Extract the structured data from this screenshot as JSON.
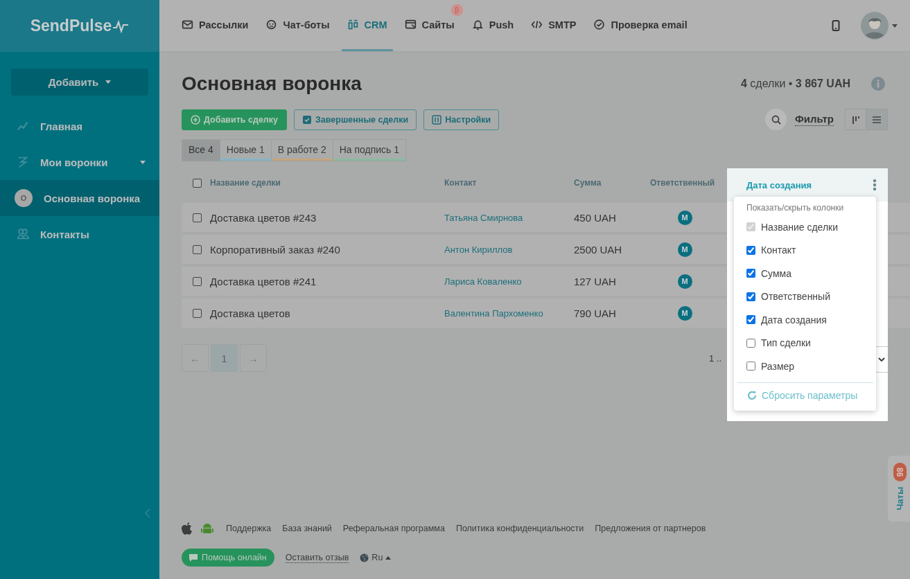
{
  "logo": {
    "text": "SendPulse"
  },
  "nav": [
    {
      "label": "Рассылки",
      "selected": false
    },
    {
      "label": "Чат-боты",
      "selected": false
    },
    {
      "label": "CRM",
      "selected": true
    },
    {
      "label": "Сайты",
      "selected": false,
      "badge": "β"
    },
    {
      "label": "Push",
      "selected": false
    },
    {
      "label": "SMTP",
      "selected": false
    },
    {
      "label": "Проверка email",
      "selected": false
    }
  ],
  "sidebar": {
    "add_button": "Добавить",
    "items": [
      {
        "label": "Главная",
        "selected": false
      },
      {
        "label": "Мои воронки",
        "selected": false,
        "expanded": true,
        "children": [
          {
            "label": "Основная воронка",
            "avatar": "О",
            "selected": true
          }
        ]
      },
      {
        "label": "Контакты",
        "selected": false
      }
    ]
  },
  "page": {
    "title": "Основная воронка",
    "summary": "**4** сделки • **3 867 UAH**"
  },
  "actions": [
    {
      "label": "Добавить сделку",
      "kind": "primary"
    },
    {
      "label": "Завершенные сделки",
      "kind": "outline"
    },
    {
      "label": "Настройки",
      "kind": "outline"
    }
  ],
  "filter": {
    "label": "Фильтр"
  },
  "views": [
    {
      "kind": "kanban",
      "selected": false
    },
    {
      "kind": "list",
      "selected": true
    }
  ],
  "stages": [
    {
      "label": "Все 4",
      "selected": true
    },
    {
      "label": "Новые 1",
      "selected": false,
      "color": "#86b3c4"
    },
    {
      "label": "В работе 2",
      "selected": false,
      "color": "#c7a37c"
    },
    {
      "label": "На подпись 1",
      "selected": false,
      "color": "#88bb9f"
    }
  ],
  "table": {
    "select_all": {
      "checked": false
    },
    "columns": [
      "Название сделки",
      "Контакт",
      "Сумма",
      "Ответственный",
      "Дата создания"
    ],
    "rows": [
      {
        "checked": false,
        "name": "Доставка цветов #243",
        "contact": "Татьяна Смирнова",
        "amount": "450 UAH",
        "responsible": "М"
      },
      {
        "checked": false,
        "name": "Корпоративный заказ #240",
        "contact": "Антон Кириллов",
        "amount": "2500 UAH",
        "responsible": "М"
      },
      {
        "checked": false,
        "name": "Доставка цветов #241",
        "contact": "Лариса Коваленко",
        "amount": "127 UAH",
        "responsible": "М"
      },
      {
        "checked": false,
        "name": "Доставка цветов",
        "contact": "Валентина Пархоменко",
        "amount": "790 UAH",
        "responsible": "М"
      }
    ]
  },
  "column_menu": {
    "title": "Показать/скрыть колонки",
    "options": [
      {
        "label": "Название сделки",
        "checked": true,
        "disabled": true
      },
      {
        "label": "Контакт",
        "checked": true,
        "disabled": false
      },
      {
        "label": "Сумма",
        "checked": true,
        "disabled": false
      },
      {
        "label": "Ответственный",
        "checked": true,
        "disabled": false
      },
      {
        "label": "Дата создания",
        "checked": true,
        "disabled": false
      },
      {
        "label": "Тип сделки",
        "checked": false,
        "disabled": false
      },
      {
        "label": "Размер",
        "checked": false,
        "disabled": false
      }
    ],
    "reset": "Сбросить параметры"
  },
  "pagination": {
    "prev": "←",
    "pages": [
      {
        "label": "1",
        "selected": true
      }
    ],
    "next": "→",
    "info": "1 .."
  },
  "footer": {
    "links": [
      "Поддержка",
      "База знаний",
      "Реферальная программа",
      "Политика конфиденциальности",
      "Предложения от партнеров"
    ],
    "help": "Помощь онлайн",
    "feedback": "Оставить отзыв",
    "language": "Ru"
  },
  "chat": {
    "label": "Чаты",
    "badge": "86"
  }
}
